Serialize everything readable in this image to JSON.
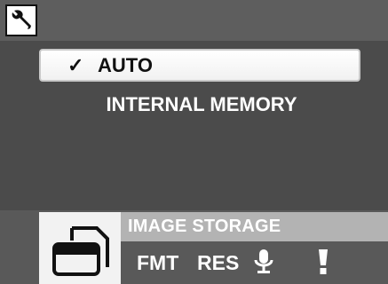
{
  "header": {
    "icon": "wrench-icon"
  },
  "menu": {
    "items": [
      {
        "check": "✓",
        "label": "AUTO",
        "selected": true
      },
      {
        "label": "INTERNAL MEMORY",
        "selected": false
      }
    ]
  },
  "footer": {
    "active_tab": {
      "icon": "memory-card-icon",
      "label": "IMAGE STORAGE"
    },
    "tabs": [
      {
        "label": "FMT"
      },
      {
        "label": "RES"
      },
      {
        "icon": "microphone-icon"
      },
      {
        "icon": "exclamation-icon"
      }
    ]
  },
  "colors": {
    "background": "#4b4b4b",
    "top_bar": "#5e5e5e",
    "label_bar": "#b3b3b3",
    "highlight": "#ffffff"
  }
}
